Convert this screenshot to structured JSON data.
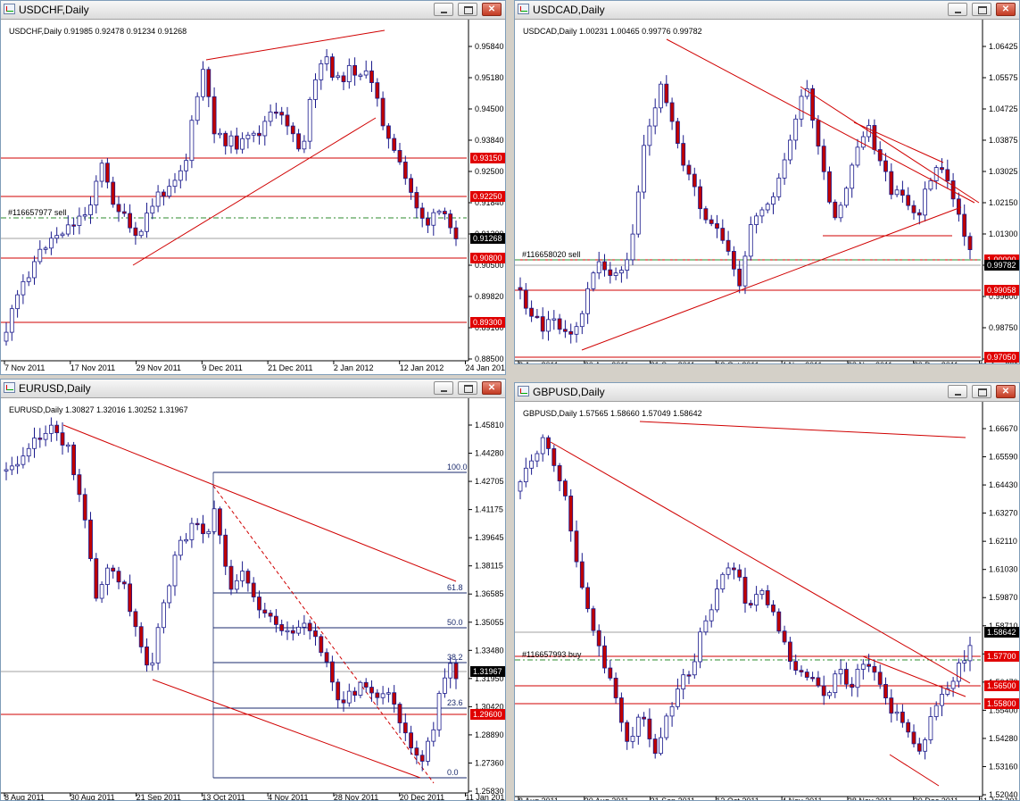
{
  "windows": [
    {
      "id": "usdchf",
      "title": "USDCHF,Daily",
      "info": "USDCHF,Daily  0.91985 0.92478 0.91234 0.91268",
      "order_label": "#116657977 sell",
      "date_labels": [
        "7 Nov 2011",
        "17 Nov 2011",
        "29 Nov 2011",
        "9 Dec 2011",
        "21 Dec 2011",
        "2 Jan 2012",
        "12 Jan 2012",
        "24 Jan 2012"
      ],
      "price_labels": [
        "0.95840",
        "0.95180",
        "0.94500",
        "0.93840",
        "0.92500",
        "0.91840",
        "0.91200",
        "0.90500",
        "0.89820",
        "0.89160",
        "0.88500"
      ],
      "level_tags": [
        {
          "price": "0.93150",
          "color": "#e00000"
        },
        {
          "price": "0.92250",
          "color": "#e00000"
        },
        {
          "price": "0.91268",
          "color": "#000000"
        },
        {
          "price": "0.90800",
          "color": "#e00000"
        },
        {
          "price": "0.89300",
          "color": "#e00000"
        }
      ]
    },
    {
      "id": "usdcad",
      "title": "USDCAD,Daily",
      "info": "USDCAD,Daily  1.00231 1.00465 0.99776 0.99782",
      "order_label": "#116658020 sell",
      "date_labels": [
        "8 Aug 2011",
        "30 Aug 2011",
        "21 Sep 2011",
        "13 Oct 2011",
        "4 Nov 2011",
        "28 Nov 2011",
        "20 Dec 2011",
        "11 Jan 2012"
      ],
      "price_labels": [
        "1.06425",
        "1.05575",
        "1.04725",
        "1.03875",
        "1.03025",
        "1.02150",
        "1.01300",
        "1.00450",
        "0.99600",
        "0.98750",
        "0.97900"
      ],
      "level_tags": [
        {
          "price": "1.00000",
          "color": "#e00000"
        },
        {
          "price": "0.99782",
          "color": "#000000"
        },
        {
          "price": "0.99058",
          "color": "#e00000"
        },
        {
          "price": "0.97050",
          "color": "#e00000"
        }
      ]
    },
    {
      "id": "eurusd",
      "title": "EURUSD,Daily",
      "info": "EURUSD,Daily  1.30827 1.32016 1.30252 1.31967",
      "order_label": "",
      "date_labels": [
        "8 Aug 2011",
        "30 Aug 2011",
        "21 Sep 2011",
        "13 Oct 2011",
        "4 Nov 2011",
        "28 Nov 2011",
        "20 Dec 2011",
        "11 Jan 2012"
      ],
      "price_labels": [
        "1.45810",
        "1.44280",
        "1.42705",
        "1.41175",
        "1.39645",
        "1.38115",
        "1.36585",
        "1.35055",
        "1.33480",
        "1.31950",
        "1.30420",
        "1.28890",
        "1.27360",
        "1.25830"
      ],
      "level_tags": [
        {
          "price": "1.31967",
          "color": "#000000"
        },
        {
          "price": "1.29600",
          "color": "#e00000"
        }
      ],
      "fib_labels": [
        "100.0",
        "61.8",
        "50.0",
        "38.2",
        "23.6",
        "0.0"
      ]
    },
    {
      "id": "gbpusd",
      "title": "GBPUSD,Daily",
      "info": "GBPUSD,Daily  1.57565 1.58660 1.57049 1.58642",
      "order_label": "#116657993 buy",
      "date_labels": [
        "8 Aug 2011",
        "30 Aug 2011",
        "21 Sep 2011",
        "13 Oct 2011",
        "4 Nov 2011",
        "28 Nov 2011",
        "20 Dec 2011",
        "11 Jan 2012"
      ],
      "price_labels": [
        "1.66670",
        "1.65590",
        "1.64430",
        "1.63270",
        "1.62110",
        "1.61030",
        "1.59870",
        "1.58710",
        "1.57550",
        "1.56470",
        "1.55400",
        "1.54280",
        "1.53160",
        "1.52040"
      ],
      "level_tags": [
        {
          "price": "1.58642",
          "color": "#000000"
        },
        {
          "price": "1.57700",
          "color": "#e00000"
        },
        {
          "price": "1.56500",
          "color": "#e00000"
        },
        {
          "price": "1.55800",
          "color": "#e00000"
        }
      ]
    }
  ],
  "colors": {
    "bull_fill": "#ffffff",
    "bull_stroke": "#1a1a8c",
    "bear_fill": "#c00000",
    "bear_stroke": "#1a1a8c",
    "line_red": "#d00000",
    "order_green": "#2e8b2e",
    "fib_blue": "#1a2a6c",
    "close_gray": "#a0a0a0"
  },
  "icons": {
    "window_icon": "chart-window-icon",
    "minimize": "minimize-icon",
    "maximize": "maximize-icon",
    "close": "close-icon"
  }
}
